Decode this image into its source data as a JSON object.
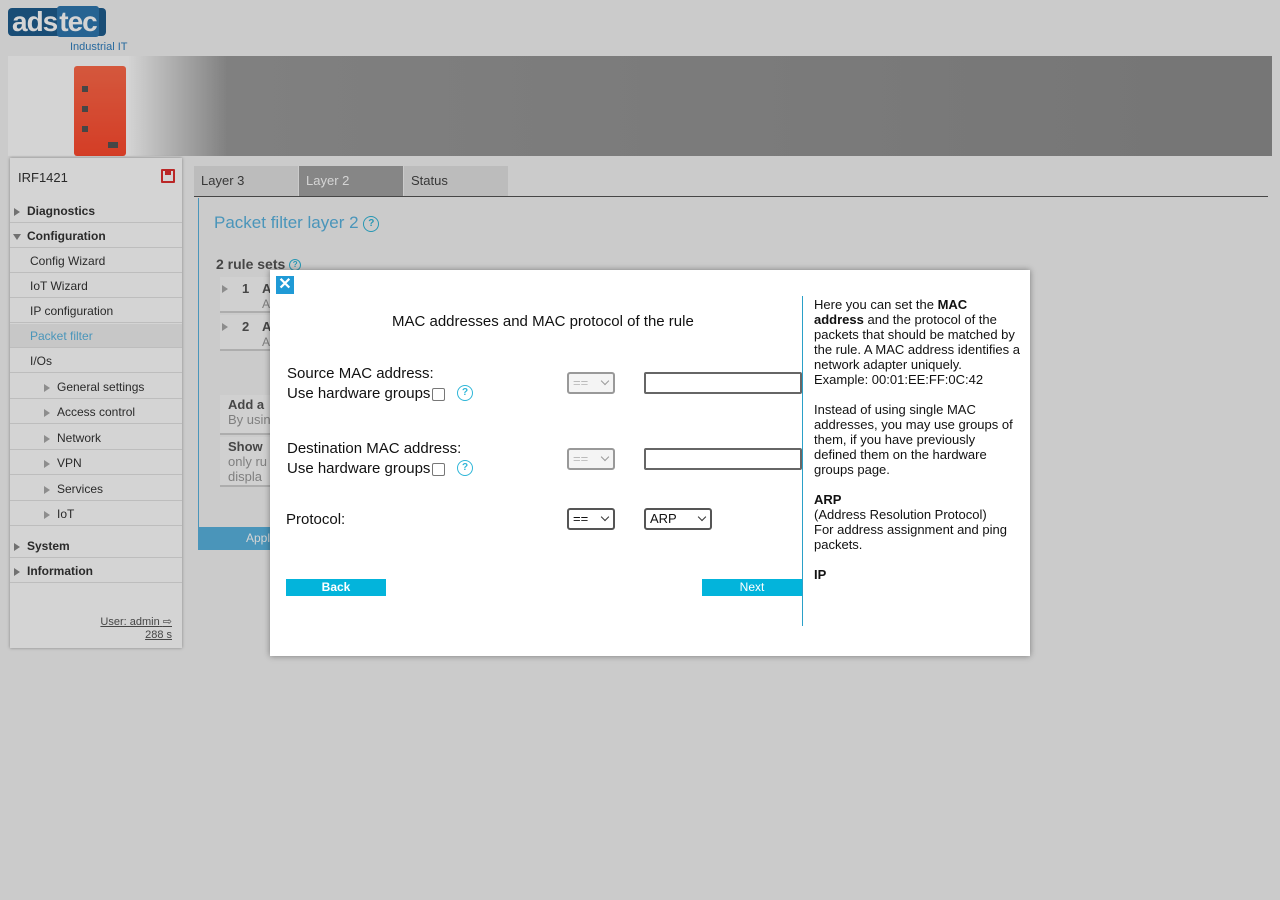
{
  "brand": {
    "logo_main": "ads",
    "logo_accent": "tec",
    "logo_sub": "Industrial IT"
  },
  "sidebar": {
    "device_name": "IRF1421",
    "items": [
      {
        "label": "Diagnostics"
      },
      {
        "label": "Configuration"
      },
      {
        "label": "Config Wizard"
      },
      {
        "label": "IoT Wizard"
      },
      {
        "label": "IP configuration"
      },
      {
        "label": "Packet filter"
      },
      {
        "label": "I/Os"
      },
      {
        "label": "General settings"
      },
      {
        "label": "Access control"
      },
      {
        "label": "Network"
      },
      {
        "label": "VPN"
      },
      {
        "label": "Services"
      },
      {
        "label": "IoT"
      },
      {
        "label": "System"
      },
      {
        "label": "Information"
      }
    ],
    "user": "User: admin",
    "session_timer": "288 s"
  },
  "tabs": [
    {
      "label": "Layer 3"
    },
    {
      "label": "Layer 2"
    },
    {
      "label": "Status"
    }
  ],
  "page": {
    "title": "Packet filter layer 2",
    "rulesets_heading": "2 rule sets",
    "rules": [
      {
        "num": "1",
        "title": "A",
        "sub": "A"
      },
      {
        "num": "2",
        "title": "A",
        "sub": "A"
      }
    ],
    "add_box": {
      "title": "Add a",
      "sub": "By usin"
    },
    "show_box": {
      "title": "Show",
      "sub1": "only ru",
      "sub2": "displa"
    },
    "apply_label": "Appl"
  },
  "modal": {
    "close_symbol": "✕",
    "heading": "MAC addresses and MAC protocol of the rule",
    "source_label": "Source MAC address:",
    "source_hw_label": "Use hardware groups",
    "source_operator": "==",
    "source_value": "",
    "dest_label": "Destination MAC address:",
    "dest_hw_label": "Use hardware groups",
    "dest_operator": "==",
    "dest_value": "",
    "protocol_label": "Protocol:",
    "protocol_operator": "==",
    "protocol_value": "ARP",
    "back_label": "Back",
    "next_label": "Next",
    "help": {
      "p1_pre": "Here you can set the ",
      "p1_bold": "MAC address",
      "p1_post": " and the protocol of the packets that should be matched by the rule. A MAC address identifies a network adapter uniquely.",
      "p1_example": "Example: 00:01:EE:FF:0C:42",
      "p2": "Instead of using single MAC addresses, you may use groups of them, if you have previously defined them on the hardware groups page.",
      "arp_title": "ARP",
      "arp_line1": "(Address Resolution Protocol)",
      "arp_line2": "For address assignment and ping packets.",
      "ip_title": "IP"
    }
  },
  "colors": {
    "accent": "#59b4e0",
    "button": "#03b4db",
    "close": "#1f9ad6",
    "save": "#e03030"
  }
}
